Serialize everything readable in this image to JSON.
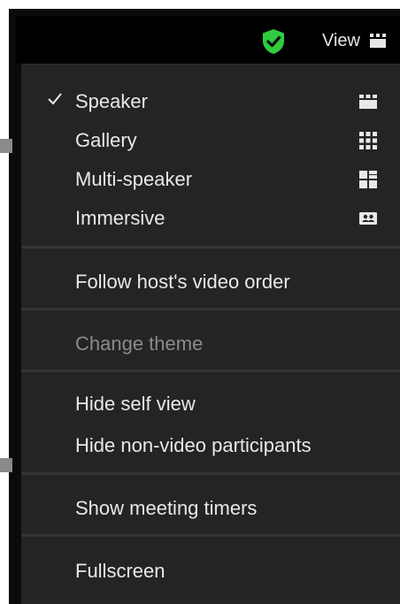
{
  "topbar": {
    "shield_icon": "shield-check-icon",
    "view_label": "View",
    "view_icon": "speaker-layout-icon",
    "accent_color": "#2ecc40"
  },
  "menu": {
    "layouts": [
      {
        "label": "Speaker",
        "checked": true,
        "icon": "speaker-layout-icon"
      },
      {
        "label": "Gallery",
        "checked": false,
        "icon": "gallery-grid-icon"
      },
      {
        "label": "Multi-speaker",
        "checked": false,
        "icon": "multi-speaker-icon"
      },
      {
        "label": "Immersive",
        "checked": false,
        "icon": "immersive-icon"
      }
    ],
    "follow_host": "Follow host's video order",
    "change_theme": "Change theme",
    "hide_self_view": "Hide self view",
    "hide_non_video": "Hide non-video participants",
    "show_timers": "Show meeting timers",
    "fullscreen": "Fullscreen"
  }
}
